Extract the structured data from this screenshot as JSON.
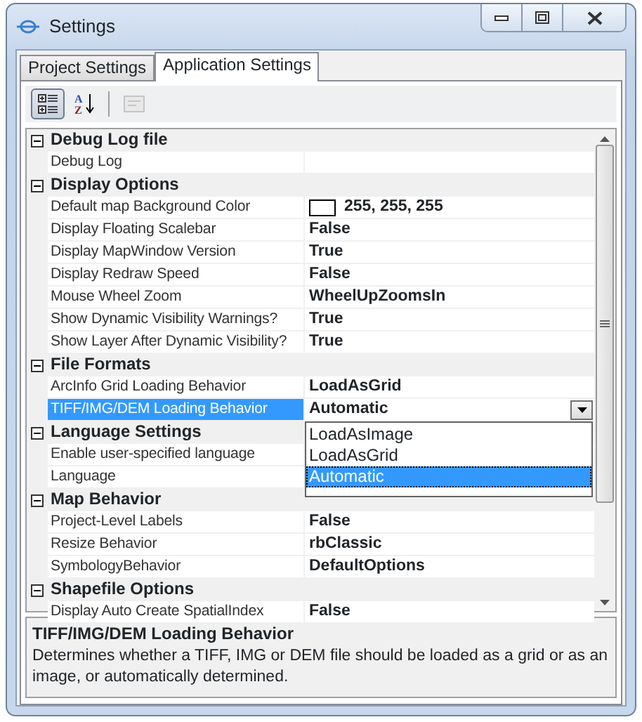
{
  "window": {
    "title": "Settings"
  },
  "tabs": [
    {
      "label": "Project Settings",
      "selected": false
    },
    {
      "label": "Application Settings",
      "selected": true
    }
  ],
  "toolbar": [
    {
      "kind": "categorized",
      "selected": true,
      "disabled": false
    },
    {
      "kind": "alphabetical",
      "selected": false,
      "disabled": false,
      "letters": [
        "A",
        "Z"
      ]
    },
    {
      "kind": "property-pages",
      "selected": false,
      "disabled": true
    }
  ],
  "grid": {
    "categories": [
      {
        "name": "Debug Log file",
        "expanded": true,
        "properties": [
          {
            "name": "Debug Log",
            "selected": false
          }
        ]
      },
      {
        "name": "Display Options",
        "expanded": true,
        "properties": [
          {
            "name": "Default map Background Color",
            "value": "255, 255, 255",
            "color": "#ffffff",
            "selected": false
          },
          {
            "name": "Display Floating Scalebar",
            "value": "False",
            "selected": false
          },
          {
            "name": "Display MapWindow Version",
            "value": "True",
            "selected": false
          },
          {
            "name": "Display Redraw Speed",
            "value": "False",
            "selected": false
          },
          {
            "name": "Mouse Wheel Zoom",
            "value": "WheelUpZoomsIn",
            "selected": false
          },
          {
            "name": "Show Dynamic Visibility Warnings?",
            "value": "True",
            "selected": false
          },
          {
            "name": "Show Layer After Dynamic Visibility?",
            "value": "True",
            "selected": false
          }
        ]
      },
      {
        "name": "File Formats",
        "expanded": true,
        "properties": [
          {
            "name": "ArcInfo Grid Loading Behavior",
            "value": "LoadAsGrid",
            "selected": false
          },
          {
            "name": "TIFF/IMG/DEM Loading Behavior",
            "value": "Automatic",
            "selected": true,
            "dropdown": {
              "open": true,
              "options": [
                {
                  "label": "LoadAsImage",
                  "selected": false
                },
                {
                  "label": "LoadAsGrid",
                  "selected": false
                },
                {
                  "label": "Automatic",
                  "selected": true
                }
              ]
            }
          }
        ]
      },
      {
        "name": "Language Settings",
        "expanded": true,
        "properties": [
          {
            "name": "Enable user-specified language",
            "selected": false
          },
          {
            "name": "Language",
            "selected": false
          }
        ]
      },
      {
        "name": "Map Behavior",
        "expanded": true,
        "properties": [
          {
            "name": "Project-Level Labels",
            "value": "False",
            "selected": false
          },
          {
            "name": "Resize Behavior",
            "value": "rbClassic",
            "selected": false
          },
          {
            "name": "SymbologyBehavior",
            "value": "DefaultOptions",
            "selected": false
          }
        ]
      },
      {
        "name": "Shapefile Options",
        "expanded": true,
        "properties": [
          {
            "name": "Display Auto Create SpatialIndex",
            "value": "False",
            "selected": false
          }
        ]
      }
    ]
  },
  "description": {
    "title": "TIFF/IMG/DEM Loading Behavior",
    "text": "Determines whether a TIFF, IMG or DEM file should be loaded as a grid or as an image, or automatically determined."
  }
}
